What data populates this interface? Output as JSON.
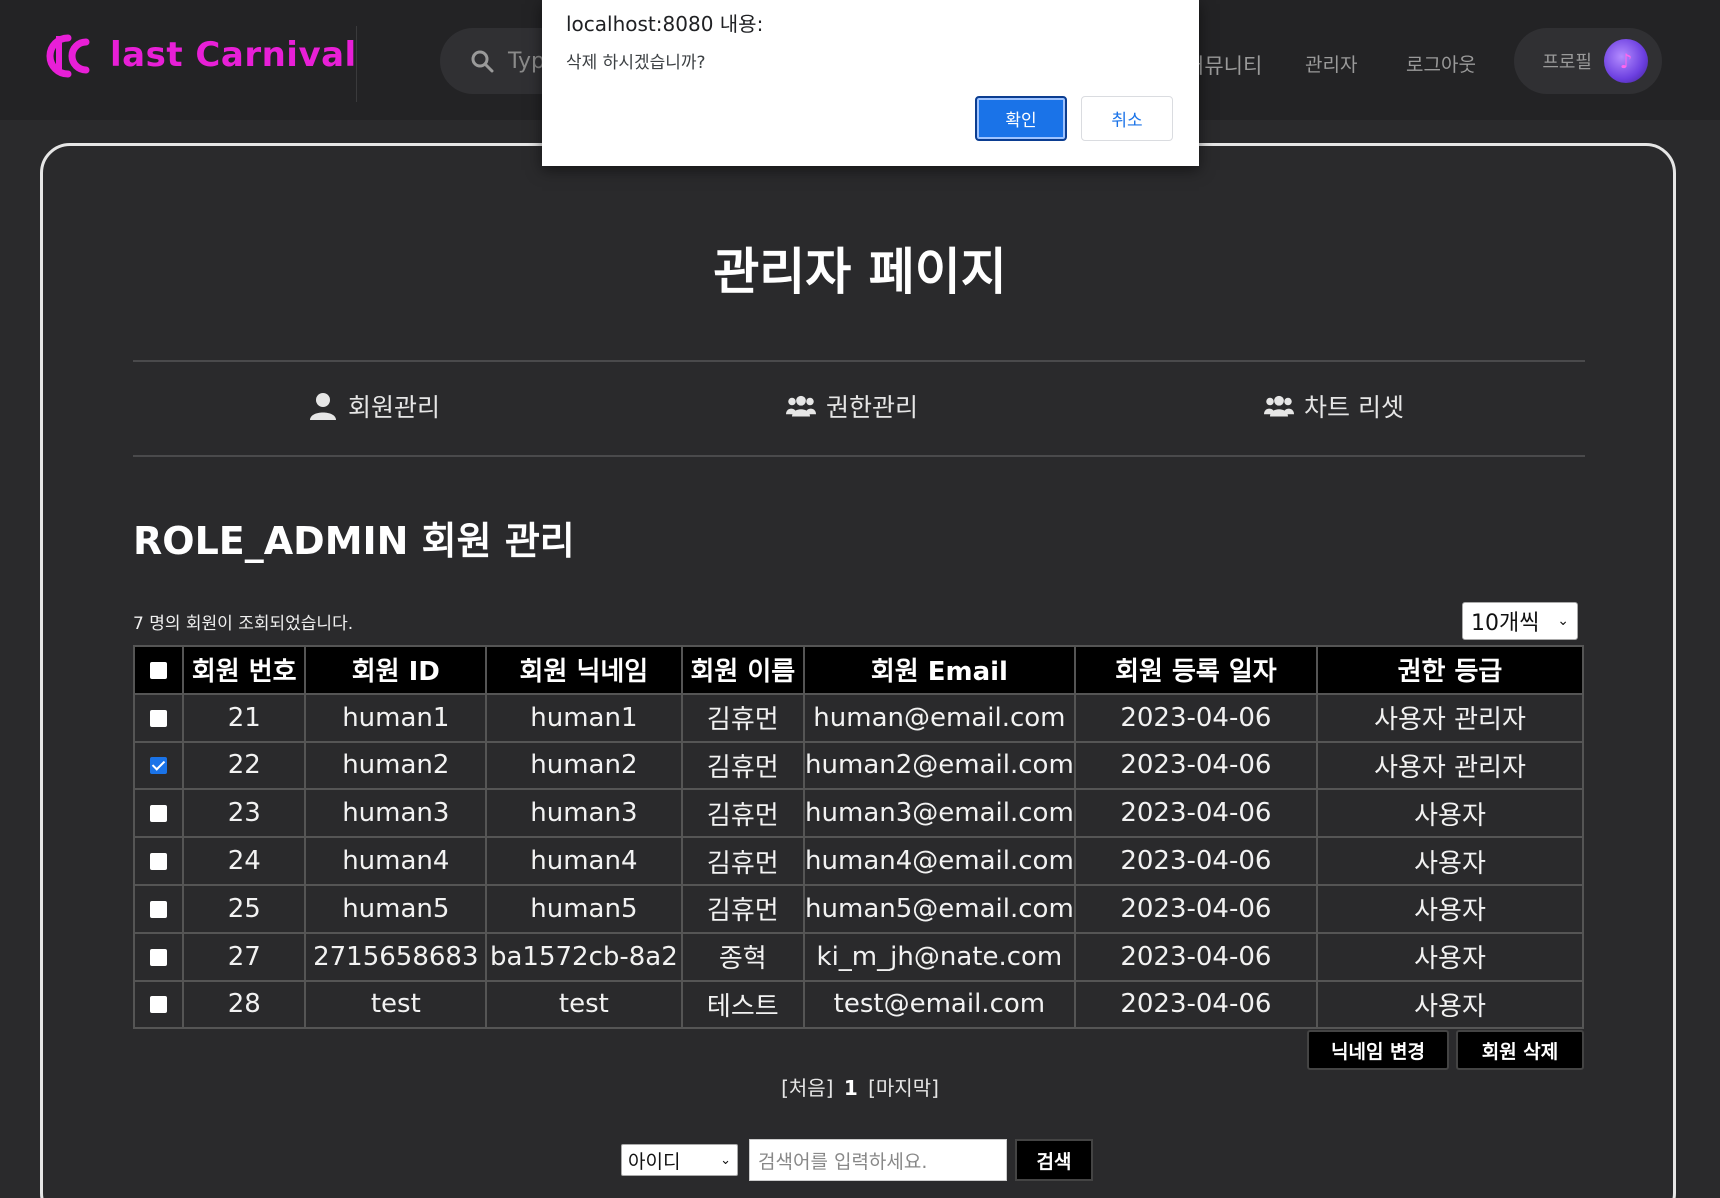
{
  "brand": {
    "logo_text": "last Carnival",
    "accent": "#e81fd7"
  },
  "header": {
    "search_placeholder": "Typ",
    "nav": [
      "커뮤니티",
      "관리자",
      "로그아웃"
    ],
    "profile_label": "프로필"
  },
  "page": {
    "title": "관리자 페이지"
  },
  "tabs": [
    {
      "label": "회원관리",
      "icon": "user-icon"
    },
    {
      "label": "권한관리",
      "icon": "users-icon"
    },
    {
      "label": "차트 리셋",
      "icon": "users-icon"
    }
  ],
  "section": {
    "title": "ROLE_ADMIN 회원 관리",
    "count_text": "7 명의 회원이 조회되었습니다.",
    "page_size": "10개씩"
  },
  "table": {
    "headers": [
      "회원 번호",
      "회원 ID",
      "회원 닉네임",
      "회원 이름",
      "회원 Email",
      "회원 등록 일자",
      "권한 등급"
    ],
    "rows": [
      {
        "checked": false,
        "cells": [
          "21",
          "human1",
          "human1",
          "김휴먼",
          "human@email.com",
          "2023-04-06",
          "사용자 관리자"
        ]
      },
      {
        "checked": true,
        "cells": [
          "22",
          "human2",
          "human2",
          "김휴먼",
          "human2@email.com",
          "2023-04-06",
          "사용자 관리자"
        ]
      },
      {
        "checked": false,
        "cells": [
          "23",
          "human3",
          "human3",
          "김휴먼",
          "human3@email.com",
          "2023-04-06",
          "사용자"
        ]
      },
      {
        "checked": false,
        "cells": [
          "24",
          "human4",
          "human4",
          "김휴먼",
          "human4@email.com",
          "2023-04-06",
          "사용자"
        ]
      },
      {
        "checked": false,
        "cells": [
          "25",
          "human5",
          "human5",
          "김휴먼",
          "human5@email.com",
          "2023-04-06",
          "사용자"
        ]
      },
      {
        "checked": false,
        "cells": [
          "27",
          "2715658683",
          "ba1572cb-8a2",
          "종혁",
          "ki_m_jh@nate.com",
          "2023-04-06",
          "사용자"
        ]
      },
      {
        "checked": false,
        "cells": [
          "28",
          "test",
          "test",
          "테스트",
          "test@email.com",
          "2023-04-06",
          "사용자"
        ]
      }
    ]
  },
  "actions": {
    "change_nickname": "닉네임 변경",
    "delete_member": "회원 삭제"
  },
  "pagination": {
    "first": "[처음]",
    "current": "1",
    "last": "[마지막]"
  },
  "search": {
    "field": "아이디",
    "placeholder": "검색어를 입력하세요.",
    "button": "검색"
  },
  "dialog": {
    "title": "localhost:8080 내용:",
    "message": "삭제 하시겠습니까?",
    "ok": "확인",
    "cancel": "취소",
    "ok_color": "#1a73e8"
  }
}
